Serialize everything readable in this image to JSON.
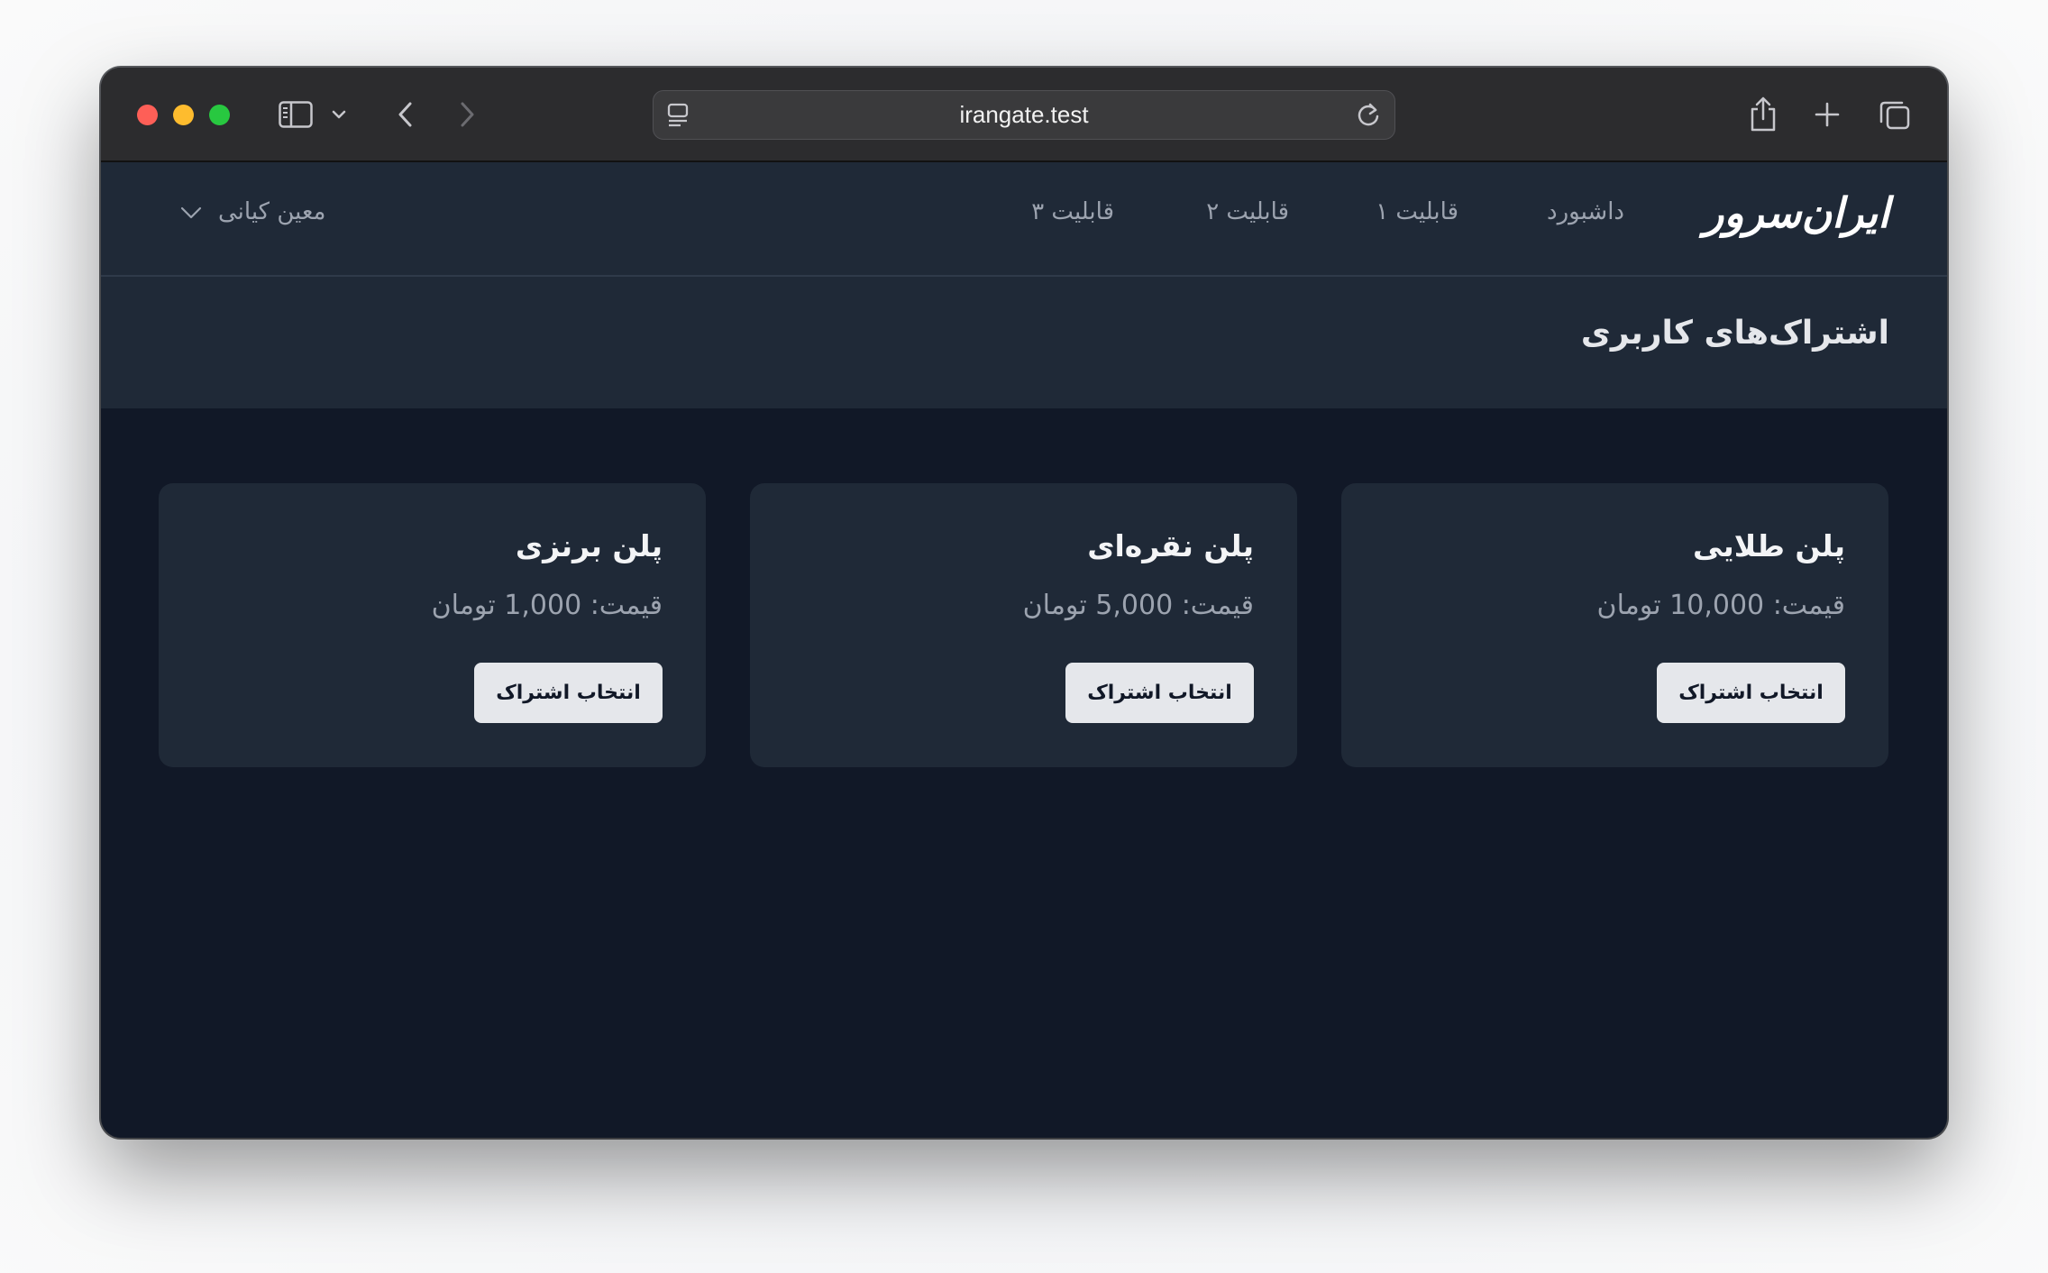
{
  "browser": {
    "url": "irangate.test"
  },
  "header": {
    "logo_text": "ایران‌سرور",
    "nav": [
      {
        "label": "داشبورد"
      },
      {
        "label": "قابلیت ۱"
      },
      {
        "label": "قابلیت ۲"
      },
      {
        "label": "قابلیت ۳"
      }
    ],
    "user_name": "معین کیانی"
  },
  "page": {
    "title": "اشتراک‌های کاربری"
  },
  "plans": [
    {
      "name": "پلن طلایی",
      "price": "قیمت: 10,000 تومان",
      "button": "انتخاب اشتراک"
    },
    {
      "name": "پلن نقره‌ای",
      "price": "قیمت: 5,000 تومان",
      "button": "انتخاب اشتراک"
    },
    {
      "name": "پلن برنزی",
      "price": "قیمت: 1,000 تومان",
      "button": "انتخاب اشتراک"
    }
  ],
  "colors": {
    "page_bg": "#111827",
    "panel_bg": "#1f2937",
    "button_bg": "#e5e7eb",
    "muted_text": "#9ca3af"
  },
  "icons": {
    "sidebar": "sidebar-icon",
    "back": "chevron-left-icon",
    "forward": "chevron-right-icon",
    "share": "share-icon",
    "new_tab": "plus-icon",
    "tabs": "tabs-overview-icon",
    "reload": "reload-icon",
    "user_menu": "chevron-down-icon"
  }
}
